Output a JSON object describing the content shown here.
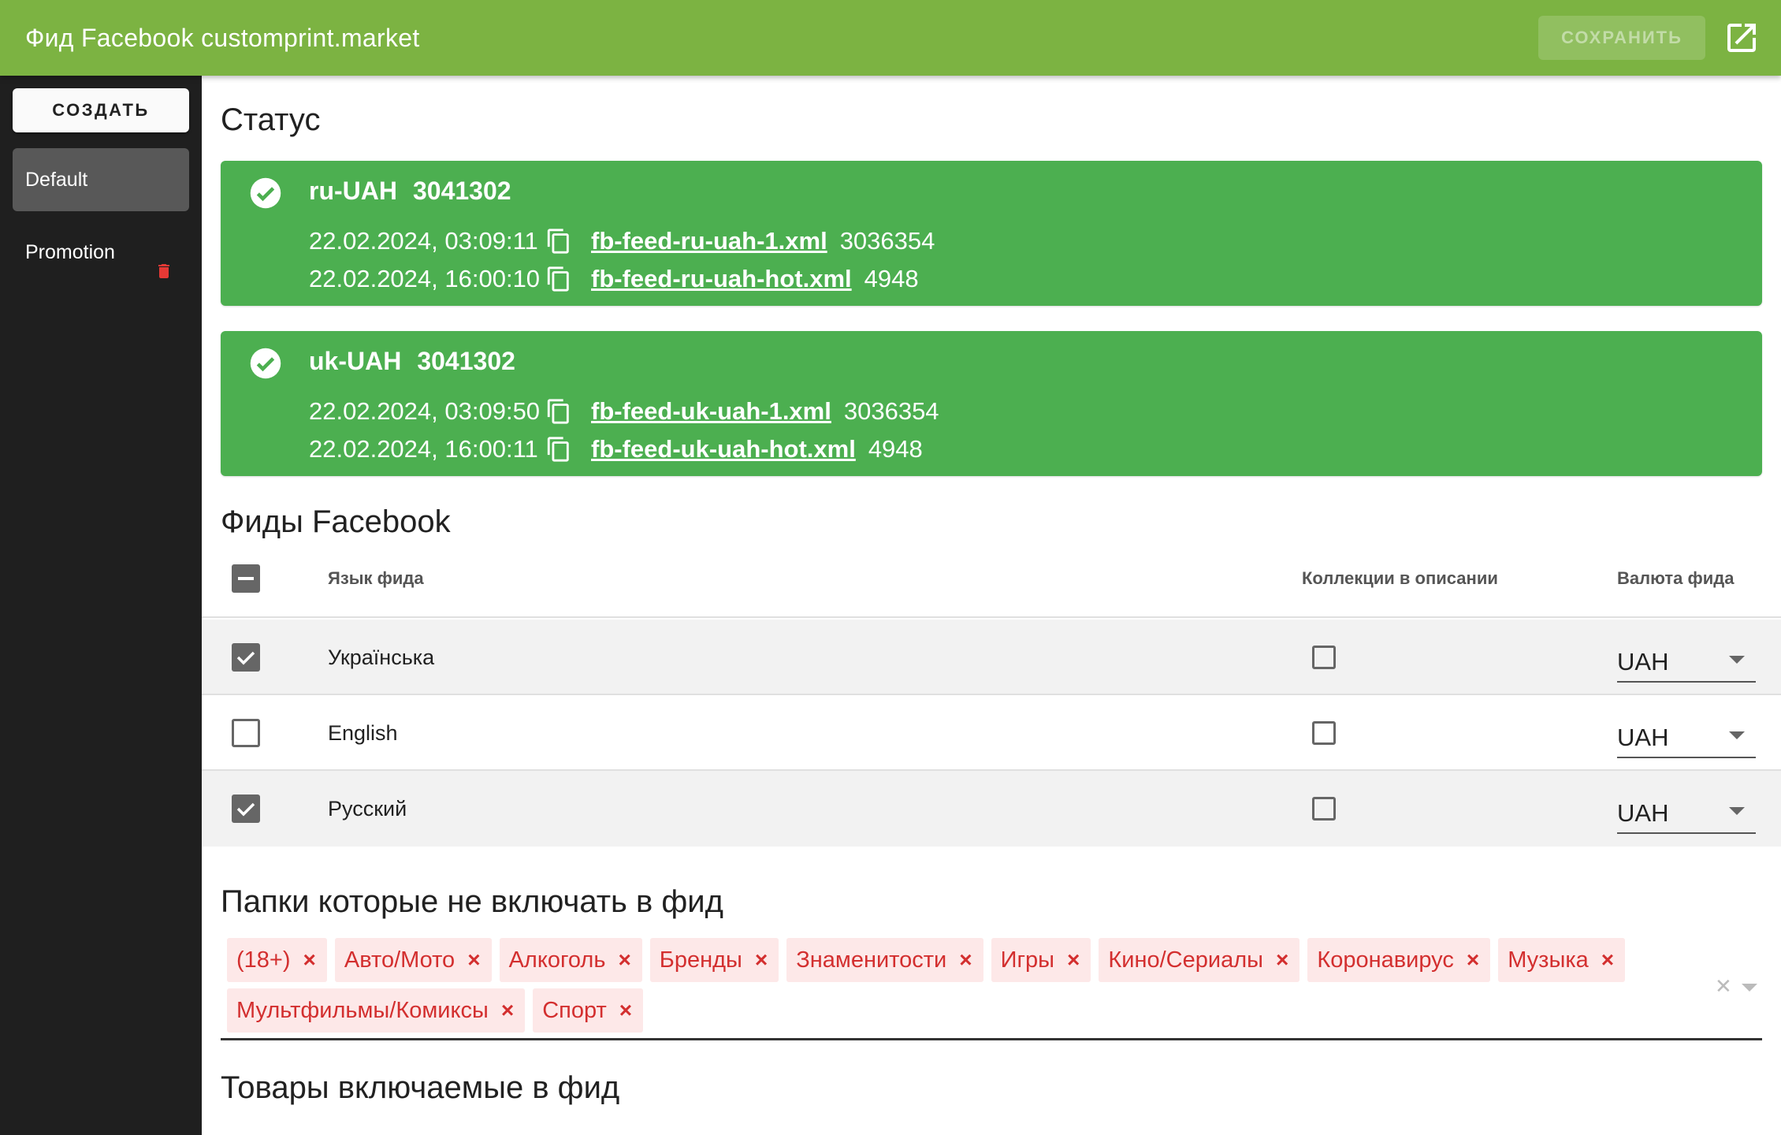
{
  "header": {
    "title": "Фид Facebook customprint.market",
    "save_label": "СОХРАНИТЬ",
    "open_icon": "open-in-new-icon"
  },
  "sidebar": {
    "create_label": "СОЗДАТЬ",
    "items": [
      {
        "label": "Default",
        "active": true
      },
      {
        "label": "Promotion",
        "active": false,
        "icon": "trash-icon"
      }
    ]
  },
  "status": {
    "title": "Статус",
    "cards": [
      {
        "locale": "ru-UAH",
        "total": "3041302",
        "files": [
          {
            "date": "22.02.2024, 03:09:11",
            "name": "fb-feed-ru-uah-1.xml",
            "count": "3036354"
          },
          {
            "date": "22.02.2024, 16:00:10",
            "name": "fb-feed-ru-uah-hot.xml",
            "count": "4948"
          }
        ]
      },
      {
        "locale": "uk-UAH",
        "total": "3041302",
        "files": [
          {
            "date": "22.02.2024, 03:09:50",
            "name": "fb-feed-uk-uah-1.xml",
            "count": "3036354"
          },
          {
            "date": "22.02.2024, 16:00:11",
            "name": "fb-feed-uk-uah-hot.xml",
            "count": "4948"
          }
        ]
      }
    ]
  },
  "feeds": {
    "title": "Фиды Facebook",
    "columns": {
      "language": "Язык фида",
      "collections": "Коллекции в описании",
      "currency": "Валюта фида"
    },
    "rows": [
      {
        "language": "Українська",
        "selected": true,
        "collections": false,
        "currency": "UAH"
      },
      {
        "language": "English",
        "selected": false,
        "collections": false,
        "currency": "UAH"
      },
      {
        "language": "Русский",
        "selected": true,
        "collections": false,
        "currency": "UAH"
      }
    ]
  },
  "excluded": {
    "title": "Папки которые не включать в фид",
    "chips": [
      "(18+)",
      "Авто/Мото",
      "Алкоголь",
      "Бренды",
      "Знаменитости",
      "Игры",
      "Кино/Сериалы",
      "Коронавирус",
      "Музыка",
      "Мультфильмы/Комиксы",
      "Спорт"
    ],
    "remove_glyph": "×"
  },
  "included": {
    "title": "Товары включаемые в фид"
  },
  "colors": {
    "topbar": "#7cb342",
    "status_ok": "#4caf50",
    "chip_bg": "#fde8e8",
    "chip_text": "#d32f2f",
    "sidebar": "#1f1f1f"
  }
}
